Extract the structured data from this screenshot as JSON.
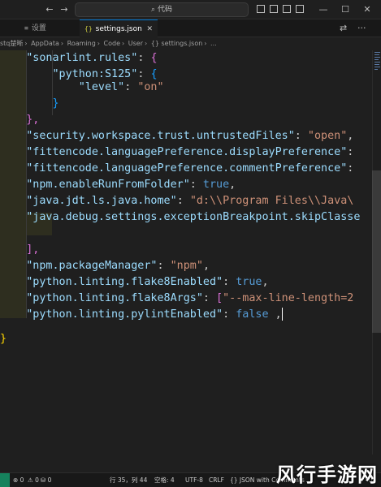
{
  "titlebar": {
    "back_icon": "←",
    "forward_icon": "→",
    "search_text": "⌕ 代码",
    "minimize_icon": "—",
    "maximize_icon": "☐",
    "close_icon": "✕"
  },
  "tabs": [
    {
      "label": "设置",
      "icon": "≡",
      "active": false
    },
    {
      "label": "settings.json",
      "icon": "{}",
      "active": true,
      "close": "✕"
    }
  ],
  "tab_actions": {
    "split": "⇄",
    "more": "···"
  },
  "breadcrumb": [
    "stq楚晰",
    "AppData",
    "Roaming",
    "Code",
    "User",
    "{} settings.json",
    "..."
  ],
  "breadcrumb_sep": "›",
  "editor": {
    "lines": [
      [
        {
          "t": "    ",
          "c": "p"
        },
        {
          "t": "\"sonarlint.rules\"",
          "c": "k"
        },
        {
          "t": ": ",
          "c": "p"
        },
        {
          "t": "{",
          "c": "b2"
        }
      ],
      [
        {
          "t": "        ",
          "c": "p"
        },
        {
          "t": "\"python:S125\"",
          "c": "k"
        },
        {
          "t": ": ",
          "c": "p"
        },
        {
          "t": "{",
          "c": "b3"
        }
      ],
      [
        {
          "t": "            ",
          "c": "p"
        },
        {
          "t": "\"level\"",
          "c": "k"
        },
        {
          "t": ": ",
          "c": "p"
        },
        {
          "t": "\"on\"",
          "c": "s"
        }
      ],
      [
        {
          "t": "        ",
          "c": "p"
        },
        {
          "t": "}",
          "c": "b3"
        }
      ],
      [
        {
          "t": "    ",
          "c": "p"
        },
        {
          "t": "},",
          "c": "b2"
        }
      ],
      [
        {
          "t": "    ",
          "c": "p"
        },
        {
          "t": "\"security.workspace.trust.untrustedFiles\"",
          "c": "k"
        },
        {
          "t": ": ",
          "c": "p"
        },
        {
          "t": "\"open\"",
          "c": "s"
        },
        {
          "t": ",",
          "c": "p"
        }
      ],
      [
        {
          "t": "    ",
          "c": "p"
        },
        {
          "t": "\"fittencode.languagePreference.displayPreference\"",
          "c": "k"
        },
        {
          "t": ":",
          "c": "p"
        }
      ],
      [
        {
          "t": "    ",
          "c": "p"
        },
        {
          "t": "\"fittencode.languagePreference.commentPreference\"",
          "c": "k"
        },
        {
          "t": ":",
          "c": "p"
        }
      ],
      [
        {
          "t": "    ",
          "c": "p"
        },
        {
          "t": "\"npm.enableRunFromFolder\"",
          "c": "k"
        },
        {
          "t": ": ",
          "c": "p"
        },
        {
          "t": "true",
          "c": "kw"
        },
        {
          "t": ",",
          "c": "p"
        }
      ],
      [
        {
          "t": "    ",
          "c": "p"
        },
        {
          "t": "\"java.jdt.ls.java.home\"",
          "c": "k"
        },
        {
          "t": ": ",
          "c": "p"
        },
        {
          "t": "\"d:\\\\Program Files\\\\Java\\",
          "c": "s"
        }
      ],
      [
        {
          "t": "    ",
          "c": "p"
        },
        {
          "t": "\"java.debug.settings.exceptionBreakpoint.skipClasse",
          "c": "k"
        }
      ],
      [
        {
          "t": "",
          "c": "p"
        }
      ],
      [
        {
          "t": "    ",
          "c": "p"
        },
        {
          "t": "],",
          "c": "b2"
        }
      ],
      [
        {
          "t": "    ",
          "c": "p"
        },
        {
          "t": "\"npm.packageManager\"",
          "c": "k"
        },
        {
          "t": ": ",
          "c": "p"
        },
        {
          "t": "\"npm\"",
          "c": "s"
        },
        {
          "t": ",",
          "c": "p"
        }
      ],
      [
        {
          "t": "    ",
          "c": "p"
        },
        {
          "t": "\"python.linting.flake8Enabled\"",
          "c": "k"
        },
        {
          "t": ": ",
          "c": "p"
        },
        {
          "t": "true",
          "c": "kw"
        },
        {
          "t": ",",
          "c": "p"
        }
      ],
      [
        {
          "t": "    ",
          "c": "p"
        },
        {
          "t": "\"python.linting.flake8Args\"",
          "c": "k"
        },
        {
          "t": ": ",
          "c": "p"
        },
        {
          "t": "[",
          "c": "b2"
        },
        {
          "t": "\"--max-line-length=2",
          "c": "s"
        }
      ],
      [
        {
          "t": "    ",
          "c": "p"
        },
        {
          "t": "\"python.linting.pylintEnabled\"",
          "c": "k"
        },
        {
          "t": ": ",
          "c": "p"
        },
        {
          "t": "false",
          "c": "kw"
        },
        {
          "t": " ,",
          "c": "p"
        }
      ],
      [
        {
          "t": "",
          "c": "p"
        }
      ],
      [
        {
          "t": "",
          "c": "p"
        }
      ],
      [
        {
          "t": "}",
          "c": "b1"
        }
      ]
    ]
  },
  "statusbar": {
    "errors": "⊗ 0",
    "warnings": "⚠ 0",
    "ports": "⛁ 0",
    "position": "行 35，列 44",
    "spaces": "空格: 4",
    "encoding": "UTF-8",
    "eol": "CRLF",
    "language": "{} JSON with Comments",
    "extra": "ⓘ"
  },
  "watermark": "风行手游网",
  "colors": {
    "accent": "#0078d4",
    "key": "#9cdcfe",
    "string": "#ce9178",
    "keyword": "#569cd6",
    "bracket_gold": "#ffd700",
    "bracket_purple": "#da70d6",
    "bracket_blue": "#179fff"
  }
}
